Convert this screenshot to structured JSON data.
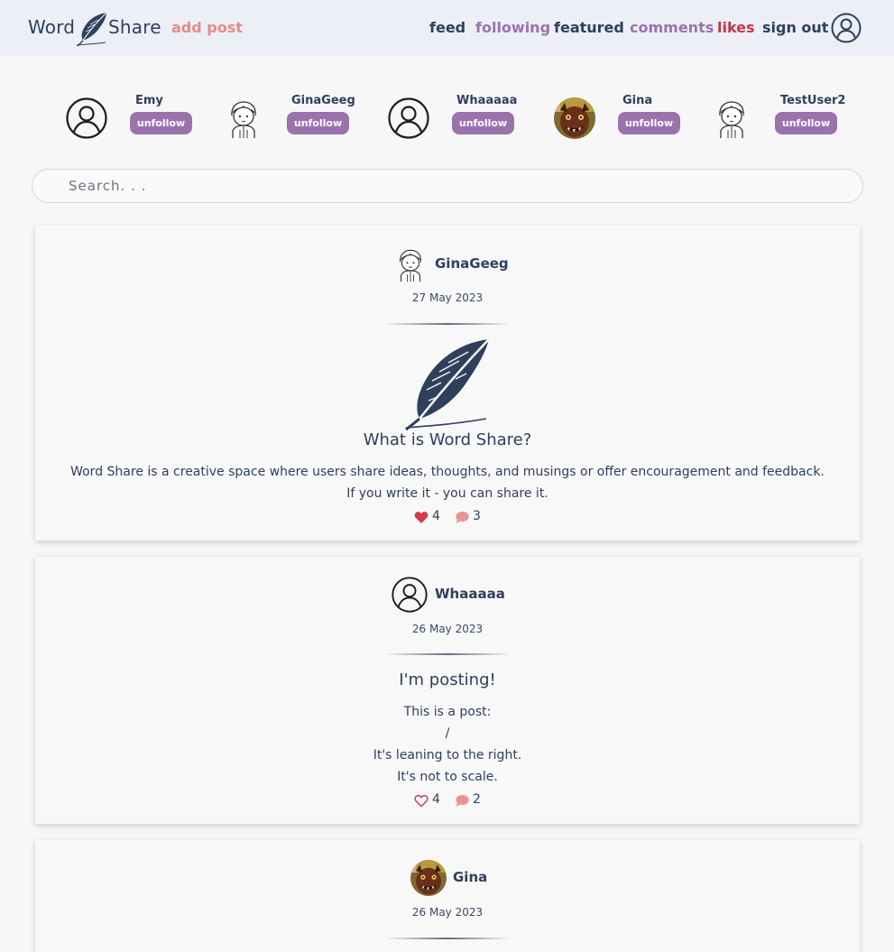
{
  "header": {
    "brand_left": "Word",
    "brand_right": "Share",
    "add_post": "add post",
    "nav": {
      "feed": "feed",
      "following": "following",
      "featured": "featured",
      "comments": "comments",
      "likes": "likes",
      "sign_out": "sign out"
    },
    "colors": {
      "background": "#eceff6",
      "text": "#2f3f5c",
      "add_post": "#e58a8a",
      "purple": "#9a72ad",
      "likes_red": "#c7344a"
    }
  },
  "following": [
    {
      "name": "Emy",
      "action": "unfollow",
      "avatar": "user-outline-icon"
    },
    {
      "name": "GinaGeeg",
      "action": "unfollow",
      "avatar": "cartoon-boy-avatar"
    },
    {
      "name": "Whaaaaa",
      "action": "unfollow",
      "avatar": "user-outline-icon"
    },
    {
      "name": "Gina",
      "action": "unfollow",
      "avatar": "monster-photo-avatar"
    },
    {
      "name": "TestUser2",
      "action": "unfollow",
      "avatar": "cartoon-boy-avatar"
    }
  ],
  "search": {
    "placeholder": "Search. . .",
    "value": ""
  },
  "posts": [
    {
      "author": "GinaGeeg",
      "avatar": "cartoon-boy-avatar",
      "date": "27 May 2023",
      "image": "quill-feather-icon",
      "title": "What is Word Share?",
      "body": [
        "Word Share is a creative space where users share ideas, thoughts, and musings or offer encouragement and feedback.",
        "If you write it - you can share it."
      ],
      "likes": "4",
      "liked": true,
      "comments": "3"
    },
    {
      "author": "Whaaaaa",
      "avatar": "user-outline-icon",
      "date": "26 May 2023",
      "title": "I'm posting!",
      "body": [
        "This is a post:",
        "/",
        "It's leaning to the right.",
        "It's not to scale."
      ],
      "likes": "4",
      "liked": false,
      "comments": "2"
    },
    {
      "author": "Gina",
      "avatar": "monster-photo-avatar",
      "date": "26 May 2023"
    }
  ]
}
